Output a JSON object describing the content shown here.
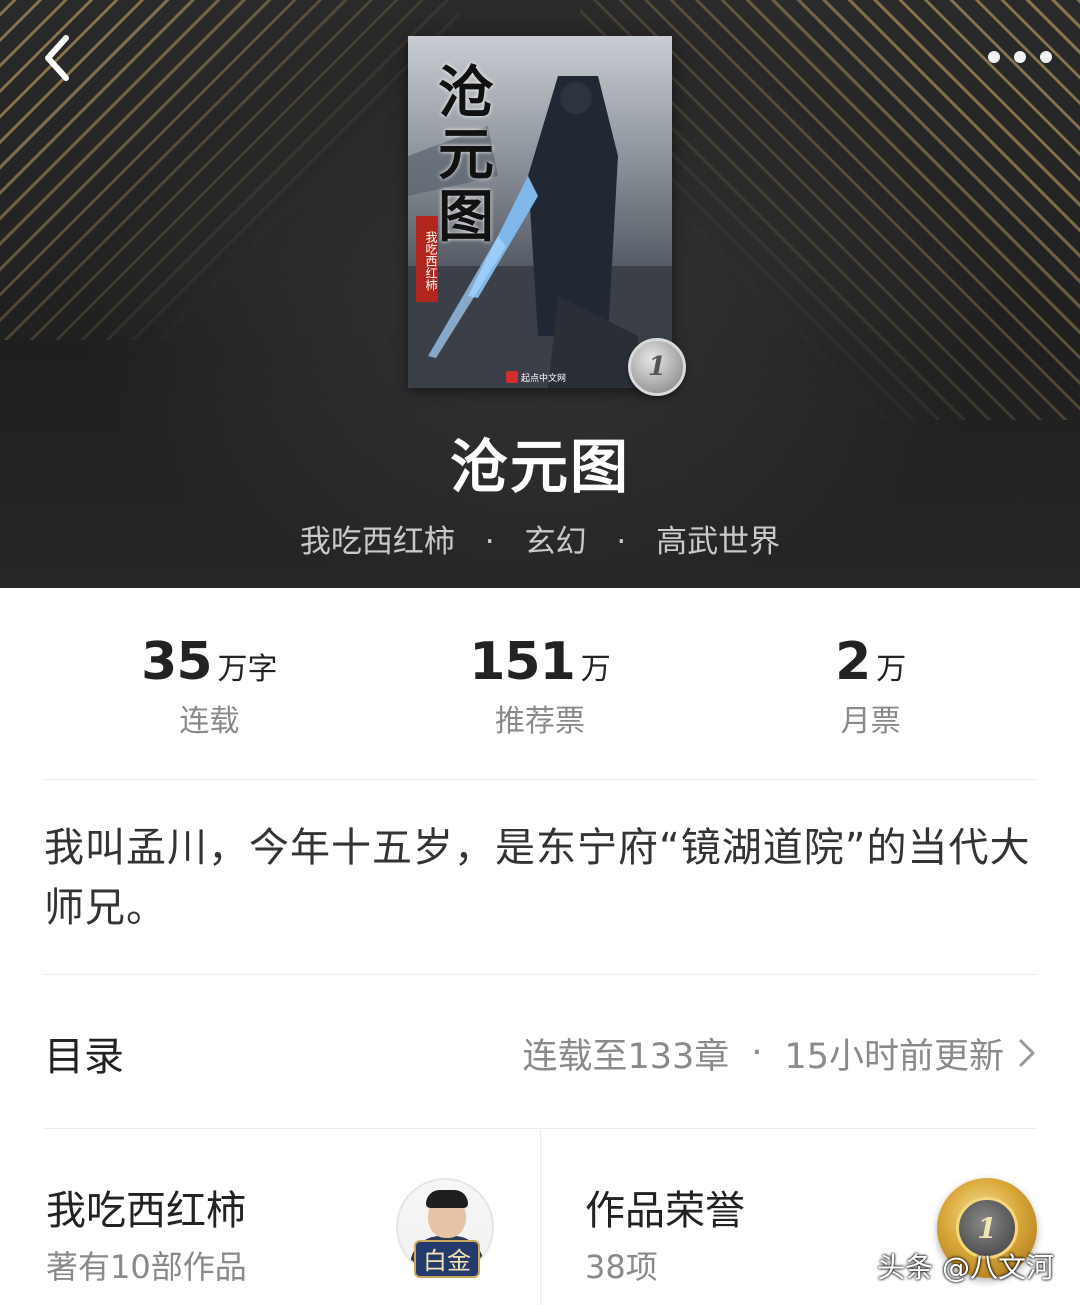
{
  "header": {
    "cover": {
      "title": "沧元图",
      "author_seal": "我吃西红柿",
      "publisher": "起点中文网"
    },
    "rank_badge": "1",
    "book_title": "沧元图",
    "author": "我吃西红柿",
    "genre": "玄幻",
    "subgenre": "高武世界",
    "separator": "·"
  },
  "stats": [
    {
      "value": "35",
      "unit": "万字",
      "label": "连载"
    },
    {
      "value": "151",
      "unit": "万",
      "label": "推荐票"
    },
    {
      "value": "2",
      "unit": "万",
      "label": "月票"
    }
  ],
  "intro": "我叫孟川，今年十五岁，是东宁府“镜湖道院”的当代大师兄。",
  "toc": {
    "title": "目录",
    "status": "连载至133章",
    "updated": "15小时前更新"
  },
  "author_card": {
    "name": "我吃西红柿",
    "works": "著有10部作品",
    "tier": "白金"
  },
  "honor_card": {
    "title": "作品荣誉",
    "count": "38项",
    "medal": "1"
  },
  "watermark": "头条 @八文河",
  "colors": {
    "header_bg": "#242424",
    "gold_stripe": "#d4af69",
    "muted_text": "#8a8a8a"
  }
}
